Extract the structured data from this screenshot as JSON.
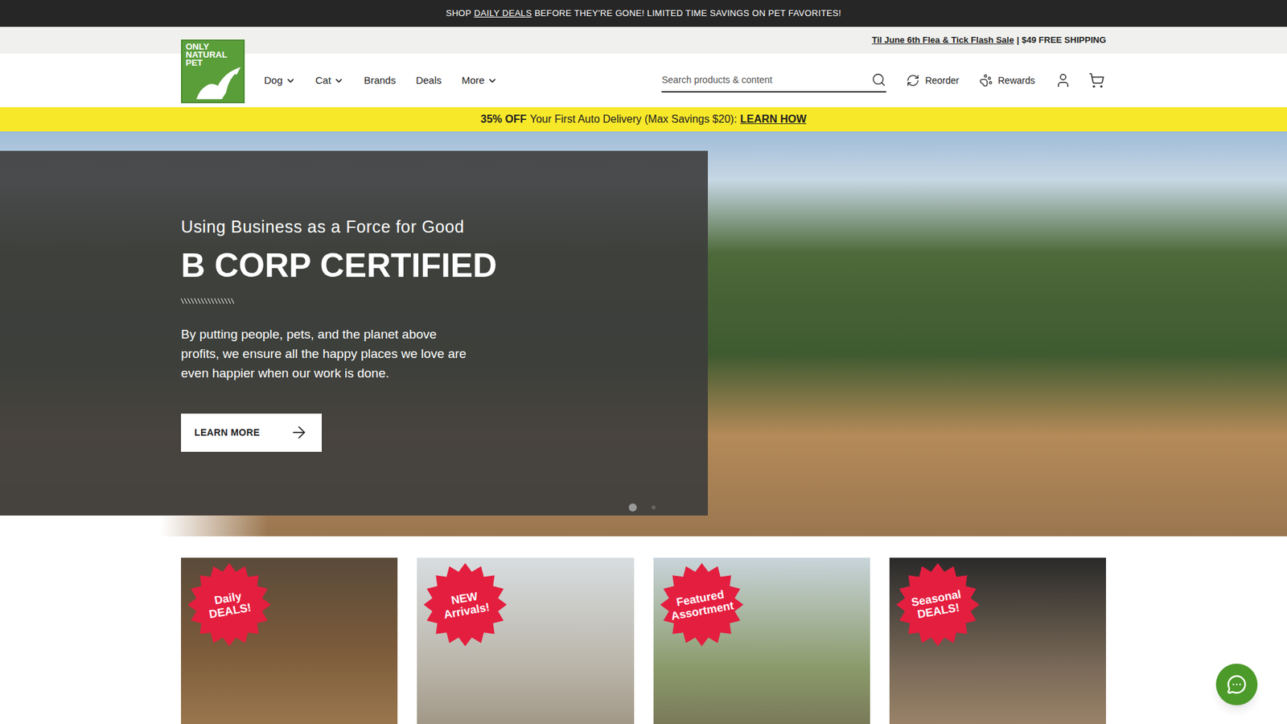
{
  "announcement": {
    "before": "SHOP",
    "link": "DAILY DEALS",
    "after": "BEFORE THEY'RE GONE! LIMITED TIME SAVINGS ON PET FAVORITES!"
  },
  "promo_bar": {
    "link": "Til June 6th Flea & Tick Flash Sale",
    "separator": "|",
    "text": "$49 FREE SHIPPING"
  },
  "logo": {
    "lines": [
      "ONLY",
      "NATURAL",
      "PET"
    ]
  },
  "nav": [
    {
      "label": "Dog",
      "dropdown": true
    },
    {
      "label": "Cat",
      "dropdown": true
    },
    {
      "label": "Brands",
      "dropdown": false
    },
    {
      "label": "Deals",
      "dropdown": false
    },
    {
      "label": "More",
      "dropdown": true
    }
  ],
  "search": {
    "placeholder": "Search products & content"
  },
  "actions": [
    {
      "label": "Reorder"
    },
    {
      "label": "Rewards"
    }
  ],
  "auto_delivery": {
    "bold": "35% OFF",
    "text": "Your First Auto Delivery (Max Savings $20):",
    "link": "LEARN HOW"
  },
  "hero": {
    "eyebrow": "Using Business as a Force for Good",
    "title": "B CORP CERTIFIED",
    "body": "By putting people, pets, and the planet above profits, we ensure all the happy places we love are even happier when our work is done.",
    "button": "LEARN MORE",
    "slides": [
      {
        "selected": true
      },
      {
        "selected": false
      }
    ]
  },
  "cards": [
    {
      "badge": [
        "Daily",
        "DEALS!"
      ]
    },
    {
      "badge": [
        "NEW",
        "Arrivals!"
      ]
    },
    {
      "badge": [
        "Featured",
        "Assortment"
      ]
    },
    {
      "badge": [
        "Seasonal",
        "DEALS!"
      ]
    }
  ]
}
